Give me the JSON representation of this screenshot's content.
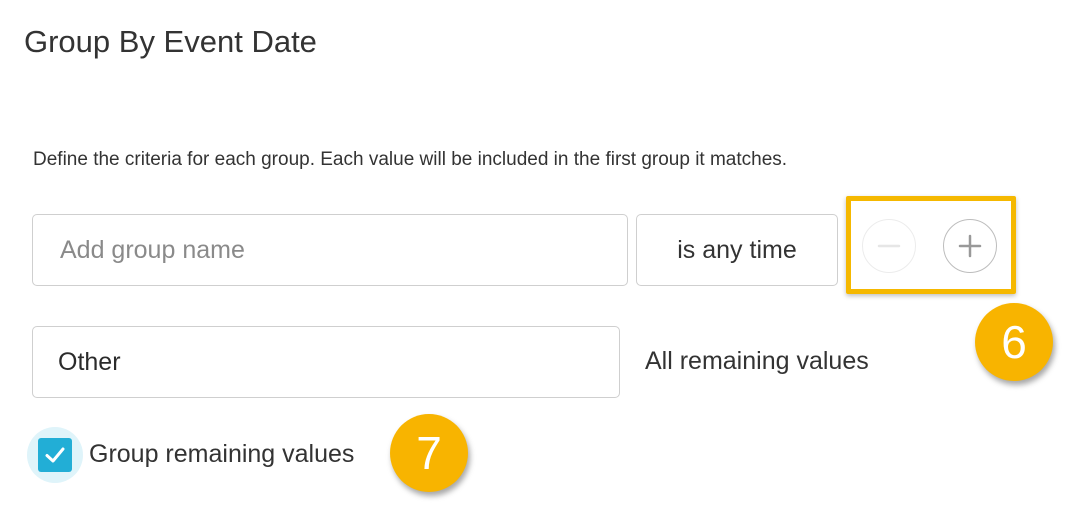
{
  "title": "Group By Event Date",
  "description": "Define the criteria for each group. Each value will be included in the first group it matches.",
  "group_row": {
    "name_placeholder": "Add group name",
    "name_value": "",
    "time_condition": "is any time"
  },
  "other_row": {
    "name_value": "Other",
    "remaining_label": "All remaining values"
  },
  "checkbox": {
    "label": "Group remaining values",
    "checked": true
  },
  "callouts": {
    "buttons_badge": "6",
    "checkbox_badge": "7"
  },
  "icons": {
    "remove": "minus-icon",
    "add": "plus-icon",
    "check": "checkmark-icon"
  },
  "colors": {
    "accent": "#22aed6",
    "highlight": "#f5b800",
    "badge": "#f8b400"
  }
}
